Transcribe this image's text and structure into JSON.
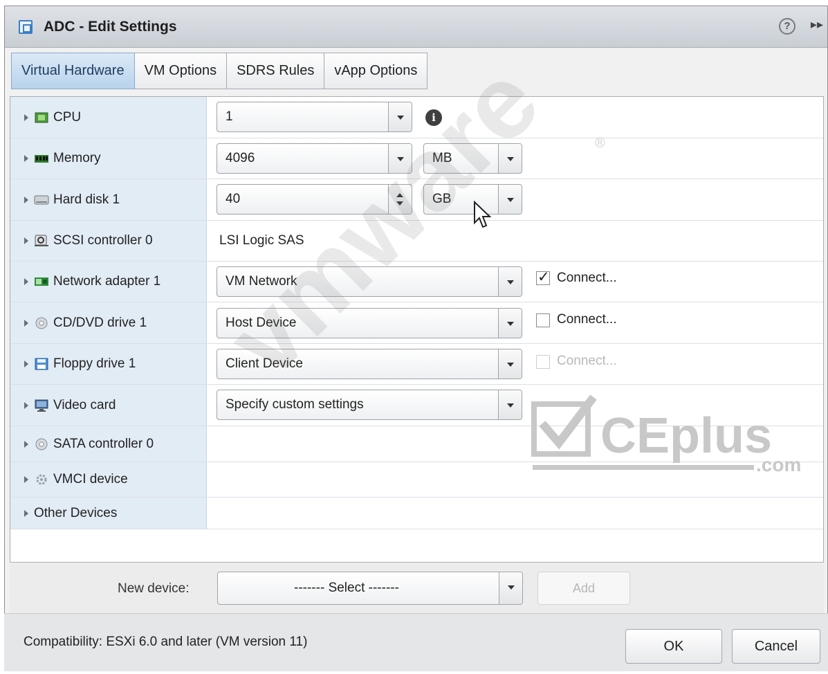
{
  "window": {
    "title": "ADC - Edit Settings",
    "help_icon": "help-circle-icon",
    "help_glyph": "?",
    "expand_icon": "expand-arrows-icon",
    "expand_glyph": "▸▸"
  },
  "tabs": [
    {
      "label": "Virtual Hardware",
      "active": true
    },
    {
      "label": "VM Options",
      "active": false
    },
    {
      "label": "SDRS Rules",
      "active": false
    },
    {
      "label": "vApp Options",
      "active": false
    }
  ],
  "hardware": {
    "cpu": {
      "label": "CPU",
      "icon": "cpu-icon",
      "value": "1",
      "info_glyph": "i"
    },
    "memory": {
      "label": "Memory",
      "icon": "memory-icon",
      "value": "4096",
      "unit": "MB"
    },
    "hard_disk": {
      "label": "Hard disk 1",
      "icon": "hard-disk-icon",
      "value": "40",
      "unit": "GB"
    },
    "scsi": {
      "label": "SCSI controller 0",
      "icon": "scsi-controller-icon",
      "value": "LSI Logic SAS"
    },
    "network": {
      "label": "Network adapter 1",
      "icon": "network-adapter-icon",
      "value": "VM Network",
      "connect_label": "Connect...",
      "connected": true
    },
    "cddvd": {
      "label": "CD/DVD drive 1",
      "icon": "cd-dvd-icon",
      "value": "Host Device",
      "connect_label": "Connect...",
      "connected": false
    },
    "floppy": {
      "label": "Floppy drive 1",
      "icon": "floppy-icon",
      "value": "Client Device",
      "connect_label": "Connect...",
      "connected": false,
      "connect_disabled": true
    },
    "video": {
      "label": "Video card",
      "icon": "video-card-icon",
      "value": "Specify custom settings"
    },
    "sata": {
      "label": "SATA controller 0",
      "icon": "sata-controller-icon"
    },
    "vmci": {
      "label": "VMCI device",
      "icon": "vmci-device-icon"
    },
    "other": {
      "label": "Other Devices"
    }
  },
  "new_device": {
    "label": "New device:",
    "select_value": "------- Select -------",
    "add_label": "Add"
  },
  "footer": {
    "compatibility": "Compatibility: ESXi 6.0 and later (VM version 11)",
    "ok_label": "OK",
    "cancel_label": "Cancel"
  },
  "watermarks": {
    "vmware": "vmware",
    "ceplus": "CEplus",
    "ceplus_suffix": ".com",
    "registered": "®"
  }
}
